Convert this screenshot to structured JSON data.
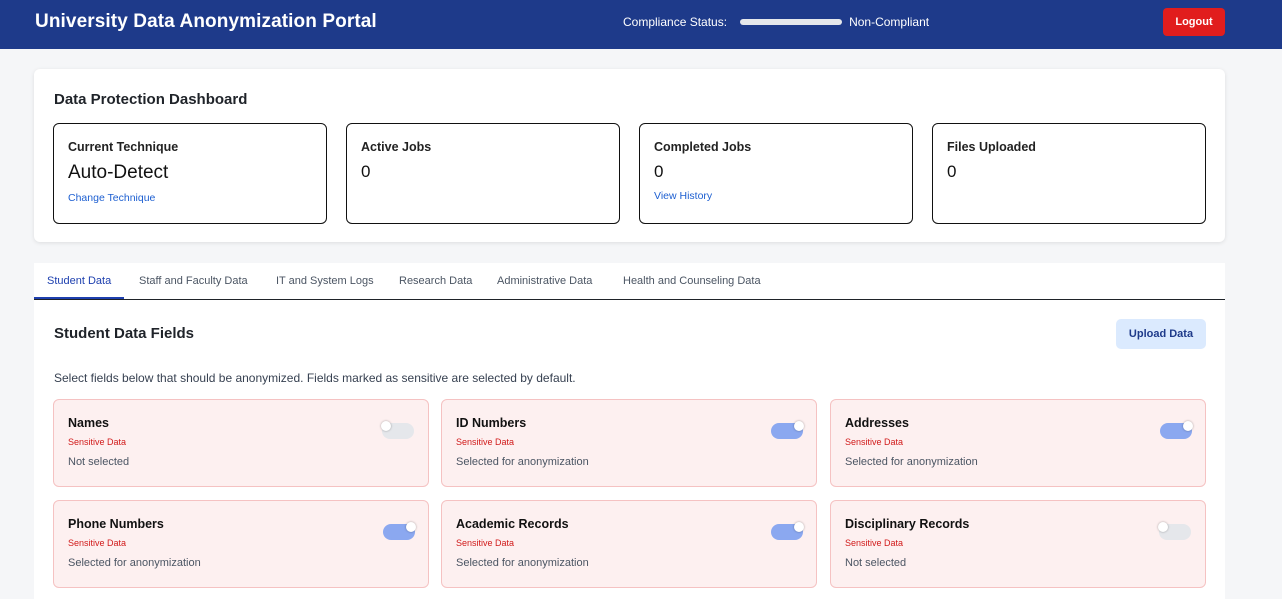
{
  "header": {
    "title": "University Data Anonymization Portal",
    "compliance_label": "Compliance Status:",
    "compliance_value": "Non-Compliant",
    "logout_label": "Logout"
  },
  "dashboard": {
    "title": "Data Protection Dashboard",
    "stats": [
      {
        "label": "Current Technique",
        "value": "Auto-Detect",
        "link": "Change Technique"
      },
      {
        "label": "Active Jobs",
        "value": "0"
      },
      {
        "label": "Completed Jobs",
        "value": "0",
        "link": "View History"
      },
      {
        "label": "Files Uploaded",
        "value": "0"
      }
    ]
  },
  "tabs": [
    {
      "label": "Student Data",
      "active": true
    },
    {
      "label": "Staff and Faculty Data"
    },
    {
      "label": "IT and System Logs"
    },
    {
      "label": "Research Data"
    },
    {
      "label": "Administrative Data"
    },
    {
      "label": "Health and Counseling Data"
    }
  ],
  "section": {
    "title": "Student Data Fields",
    "upload_label": "Upload Data",
    "description": "Select fields below that should be anonymized. Fields marked as sensitive are selected by default."
  },
  "fields": [
    {
      "name": "Names",
      "sensitivity": "Sensitive Data",
      "status": "Not selected",
      "selected": false
    },
    {
      "name": "ID Numbers",
      "sensitivity": "Sensitive Data",
      "status": "Selected for anonymization",
      "selected": true
    },
    {
      "name": "Addresses",
      "sensitivity": "Sensitive Data",
      "status": "Selected for anonymization",
      "selected": true
    },
    {
      "name": "Phone Numbers",
      "sensitivity": "Sensitive Data",
      "status": "Selected for anonymization",
      "selected": true
    },
    {
      "name": "Academic Records",
      "sensitivity": "Sensitive Data",
      "status": "Selected for anonymization",
      "selected": true
    },
    {
      "name": "Disciplinary Records",
      "sensitivity": "Sensitive Data",
      "status": "Not selected",
      "selected": false
    }
  ],
  "colors": {
    "header_bg": "#1e3a8a",
    "logout_bg": "#e11d1d",
    "accent": "#1e40af",
    "link": "#1d5fd1",
    "sensitive": "#d11a1a",
    "toggle_on": "#8ba8f0",
    "field_bg": "#fdf0f0"
  }
}
